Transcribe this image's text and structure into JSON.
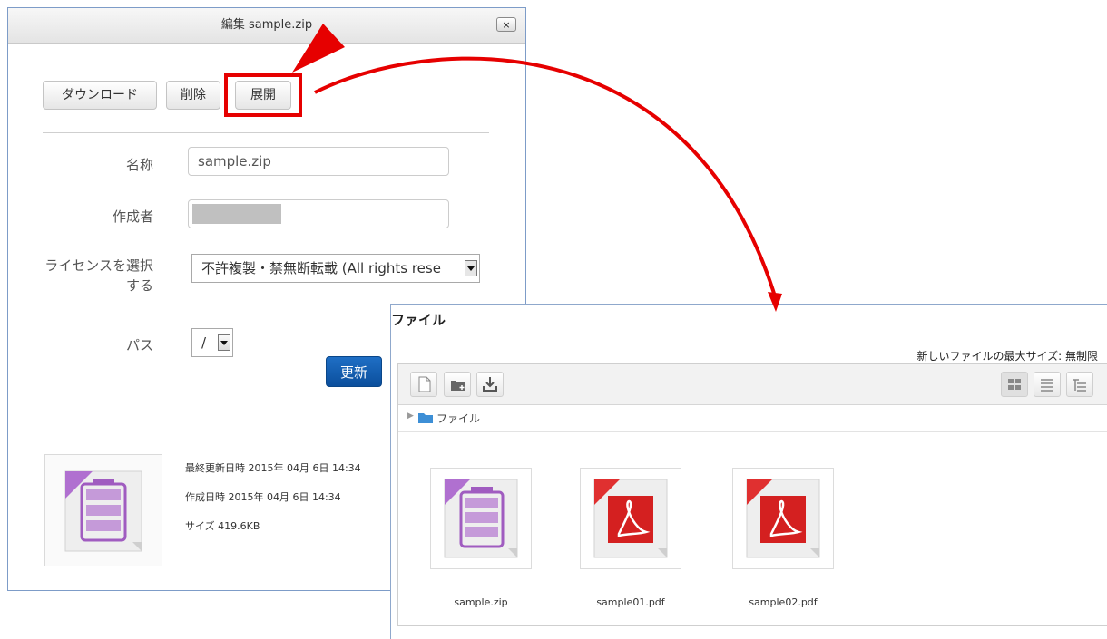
{
  "dialog": {
    "title": "編集 sample.zip",
    "close_label": "×",
    "actions": {
      "download": "ダウンロード",
      "delete": "削除",
      "extract": "展開"
    },
    "fields": {
      "name_label": "名称",
      "name_value": "sample.zip",
      "author_label": "作成者",
      "license_label_line1": "ライセンスを選択",
      "license_label_line2": "する",
      "license_value": "不許複製・禁無断転載 (All rights rese",
      "path_label": "パス",
      "path_value": "/"
    },
    "update_label": "更新",
    "info": {
      "modified": "最終更新日時  2015年 04月 6日 14:34",
      "created": "作成日時  2015年 04月 6日 14:34",
      "size": "サイズ  419.6KB"
    }
  },
  "file_manager": {
    "title": "ファイル",
    "max_size": "新しいファイルの最大サイズ: 無制限",
    "breadcrumb": "ファイル",
    "files": [
      {
        "name": "sample.zip",
        "icon": "archive-icon"
      },
      {
        "name": "sample01.pdf",
        "icon": "pdf-icon"
      },
      {
        "name": "sample02.pdf",
        "icon": "pdf-icon"
      }
    ]
  },
  "colors": {
    "annotation": "#e60000",
    "primary_button": "#0b4f9c",
    "archive": "#a05cc0",
    "pdf": "#d42020"
  }
}
